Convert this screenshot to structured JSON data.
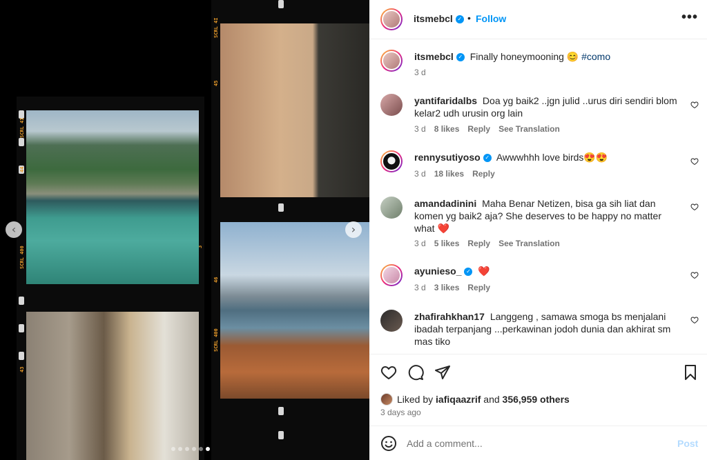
{
  "post": {
    "author": "itsmebcl",
    "follow_label": "Follow",
    "separator": "•",
    "caption": {
      "username": "itsmebcl",
      "text": "Finally honeymooning 😊",
      "hashtag": "#como",
      "time": "3 d"
    }
  },
  "media": {
    "film_labels": [
      "SCRL 4I",
      "SCRL 400",
      "44",
      "45",
      "3",
      "43",
      "46"
    ],
    "dots": 6,
    "active_dot": 5
  },
  "comments": [
    {
      "username": "yantifaridalbs",
      "verified": false,
      "text": "Doa yg baik2 ..jgn julid ..urus diri sendiri blom kelar2 udh urusin org lain",
      "time": "3 d",
      "likes": "8 likes",
      "reply": "Reply",
      "translate": "See Translation"
    },
    {
      "username": "rennysutiyoso",
      "verified": true,
      "text": "Awwwhhh love birds😍😍",
      "time": "3 d",
      "likes": "18 likes",
      "reply": "Reply",
      "translate": ""
    },
    {
      "username": "amandadinini",
      "verified": false,
      "text": "Maha Benar Netizen, bisa ga sih liat dan komen yg baik2 aja? She deserves to be happy no matter what ❤️",
      "time": "3 d",
      "likes": "5 likes",
      "reply": "Reply",
      "translate": "See Translation"
    },
    {
      "username": "ayunieso_",
      "verified": true,
      "text": "❤️",
      "time": "3 d",
      "likes": "3 likes",
      "reply": "Reply",
      "translate": ""
    },
    {
      "username": "zhafirahkhan17",
      "verified": false,
      "text": "Langgeng , samawa smoga bs menjalani ibadah terpanjang ...perkawinan jodoh dunia dan akhirat sm mas tiko",
      "time": "",
      "likes": "",
      "reply": "",
      "translate": ""
    }
  ],
  "likes_summary": {
    "prefix": "Liked by",
    "user": "iafiqaazrif",
    "middle": "and",
    "count": "356,959 others"
  },
  "posted_ago": "3 days ago",
  "add_comment": {
    "placeholder": "Add a comment...",
    "post_label": "Post"
  },
  "colors": {
    "accent": "#0095f6",
    "post_disabled": "#b3dbff",
    "film_text": "#e79a2a"
  }
}
